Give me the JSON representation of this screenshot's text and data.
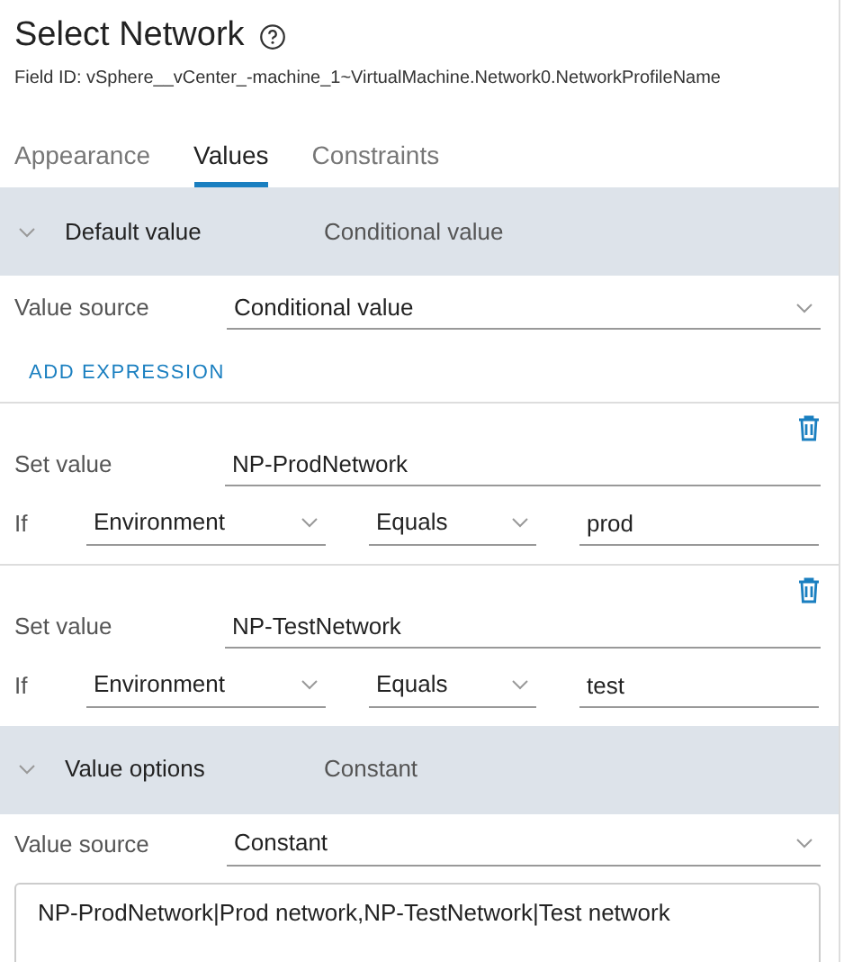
{
  "title": "Select Network",
  "field_id": "Field ID: vSphere__vCenter_-machine_1~VirtualMachine.Network0.NetworkProfileName",
  "tabs": [
    {
      "label": "Appearance",
      "selected": false
    },
    {
      "label": "Values",
      "selected": true
    },
    {
      "label": "Constraints",
      "selected": false
    }
  ],
  "sections": [
    {
      "label": "Default value",
      "value": "Conditional value",
      "source_label": "Value source",
      "source": "Conditional value",
      "add_link": "ADD EXPRESSION",
      "expressions": [
        {
          "set_label": "Set value",
          "set_value": "NP-ProdNetwork",
          "if_label": "If",
          "field": "Environment",
          "operator": "Equals",
          "operand": "prod"
        },
        {
          "set_label": "Set value",
          "set_value": "NP-TestNetwork",
          "if_label": "If",
          "field": "Environment",
          "operator": "Equals",
          "operand": "test"
        }
      ]
    },
    {
      "label": "Value options",
      "value": "Constant",
      "source_label": "Value source",
      "source": "Constant",
      "text": "NP-ProdNetwork|Prod network,NP-TestNetwork|Test network"
    }
  ]
}
